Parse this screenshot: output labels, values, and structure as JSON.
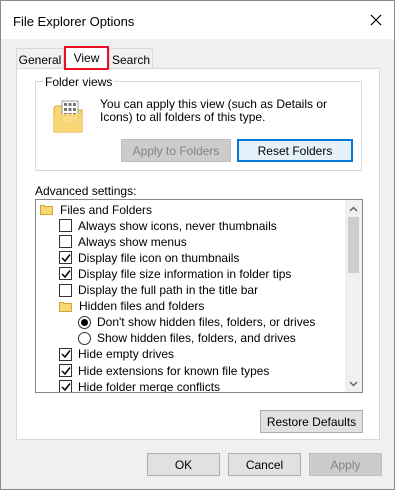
{
  "window": {
    "title": "File Explorer Options"
  },
  "tabs": [
    {
      "label": "General",
      "selected": false
    },
    {
      "label": "View",
      "selected": true
    },
    {
      "label": "Search",
      "selected": false
    }
  ],
  "folder_views": {
    "legend": "Folder views",
    "description": "You can apply this view (such as Details or Icons) to all folders of this type.",
    "apply_button": "Apply to Folders",
    "reset_button": "Reset Folders"
  },
  "advanced": {
    "label": "Advanced settings:",
    "items": [
      {
        "type": "folder",
        "label": "Files and Folders",
        "level": 0
      },
      {
        "type": "checkbox",
        "checked": false,
        "label": "Always show icons, never thumbnails",
        "level": 1
      },
      {
        "type": "checkbox",
        "checked": false,
        "label": "Always show menus",
        "level": 1
      },
      {
        "type": "checkbox",
        "checked": true,
        "label": "Display file icon on thumbnails",
        "level": 1
      },
      {
        "type": "checkbox",
        "checked": true,
        "label": "Display file size information in folder tips",
        "level": 1
      },
      {
        "type": "checkbox",
        "checked": false,
        "label": "Display the full path in the title bar",
        "level": 1
      },
      {
        "type": "folder",
        "label": "Hidden files and folders",
        "level": 1
      },
      {
        "type": "radio",
        "checked": true,
        "label": "Don't show hidden files, folders, or drives",
        "level": 2
      },
      {
        "type": "radio",
        "checked": false,
        "label": "Show hidden files, folders, and drives",
        "level": 2
      },
      {
        "type": "checkbox",
        "checked": true,
        "label": "Hide empty drives",
        "level": 1
      },
      {
        "type": "checkbox",
        "checked": true,
        "label": "Hide extensions for known file types",
        "level": 1
      },
      {
        "type": "checkbox",
        "checked": true,
        "label": "Hide folder merge conflicts",
        "level": 1
      }
    ],
    "restore_button": "Restore Defaults"
  },
  "footer": {
    "ok": "OK",
    "cancel": "Cancel",
    "apply": "Apply"
  },
  "colors": {
    "highlight_box": "#e81123",
    "focus_blue": "#0078d7",
    "folder_yellow": "#f8d775"
  }
}
